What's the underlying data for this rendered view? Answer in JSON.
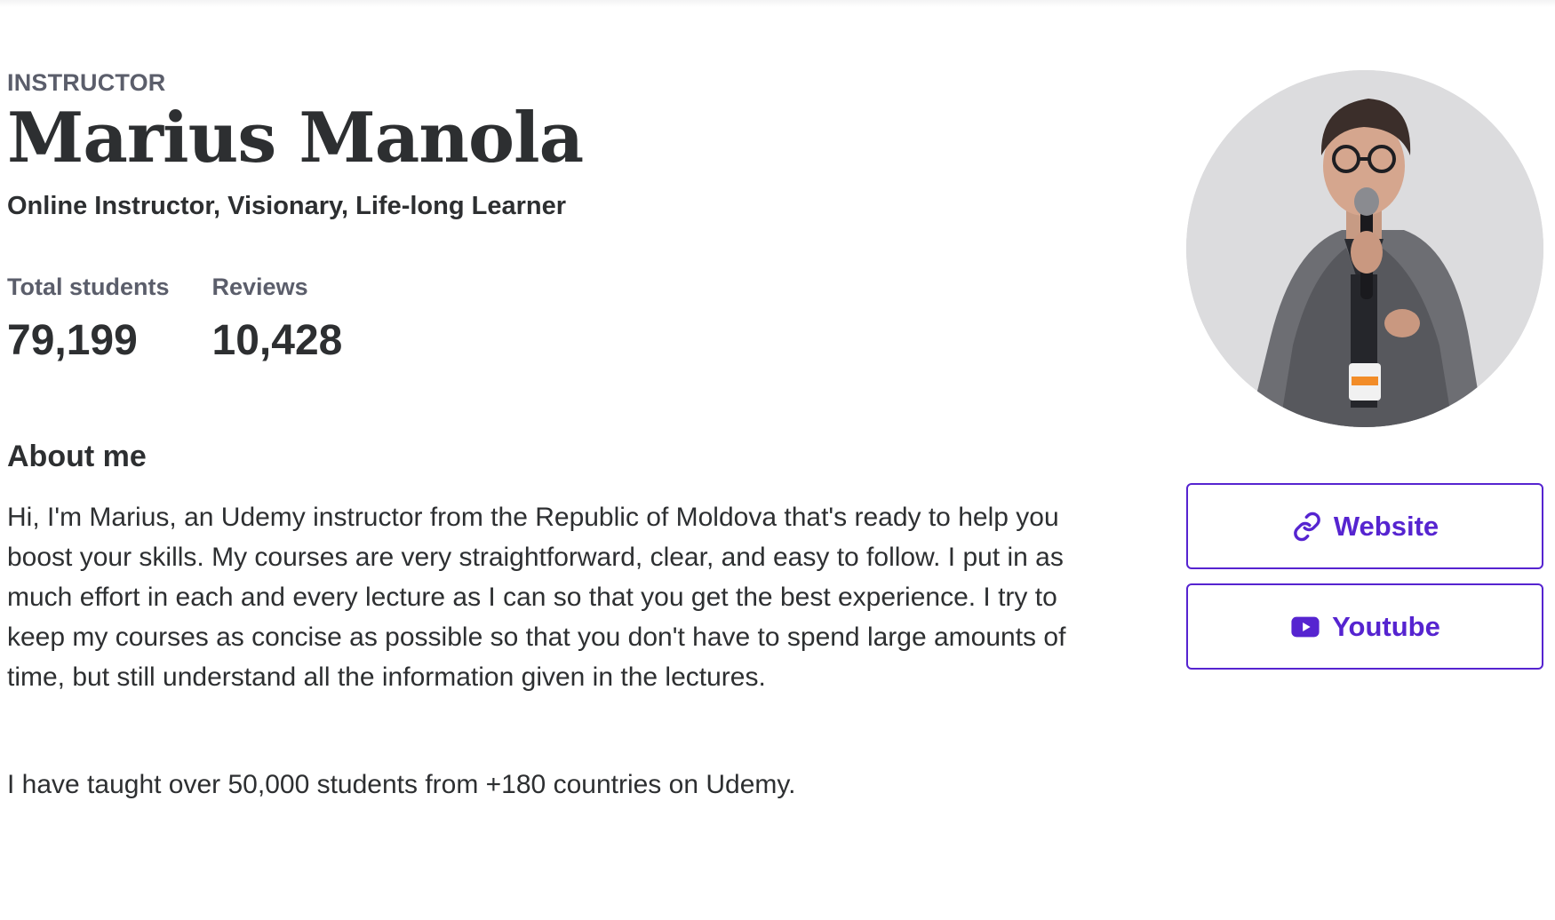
{
  "profile": {
    "eyebrow": "INSTRUCTOR",
    "name": "Marius Manola",
    "headline": "Online Instructor, Visionary, Life-long Learner"
  },
  "stats": [
    {
      "label": "Total students",
      "value": "79,199"
    },
    {
      "label": "Reviews",
      "value": "10,428"
    }
  ],
  "about": {
    "title": "About me",
    "paragraph_1": "Hi, I'm Marius, an Udemy instructor from the Republic of Moldova that's ready to help you boost your skills. My courses are very straightforward, clear, and easy to follow. I put in as much effort in each and every lecture as I can so that you get the best experience. I try to keep my courses as concise as possible so that you don't have to spend large amounts of time, but still understand all the information given in the lectures.",
    "paragraph_2": "I have taught over 50,000 students from +180 countries on Udemy."
  },
  "links": {
    "website": {
      "label": "Website",
      "icon": "link-icon"
    },
    "youtube": {
      "label": "Youtube",
      "icon": "youtube-icon"
    }
  },
  "colors": {
    "accent": "#5624d0",
    "text": "#2d2f31",
    "muted": "#5b5e6b"
  }
}
